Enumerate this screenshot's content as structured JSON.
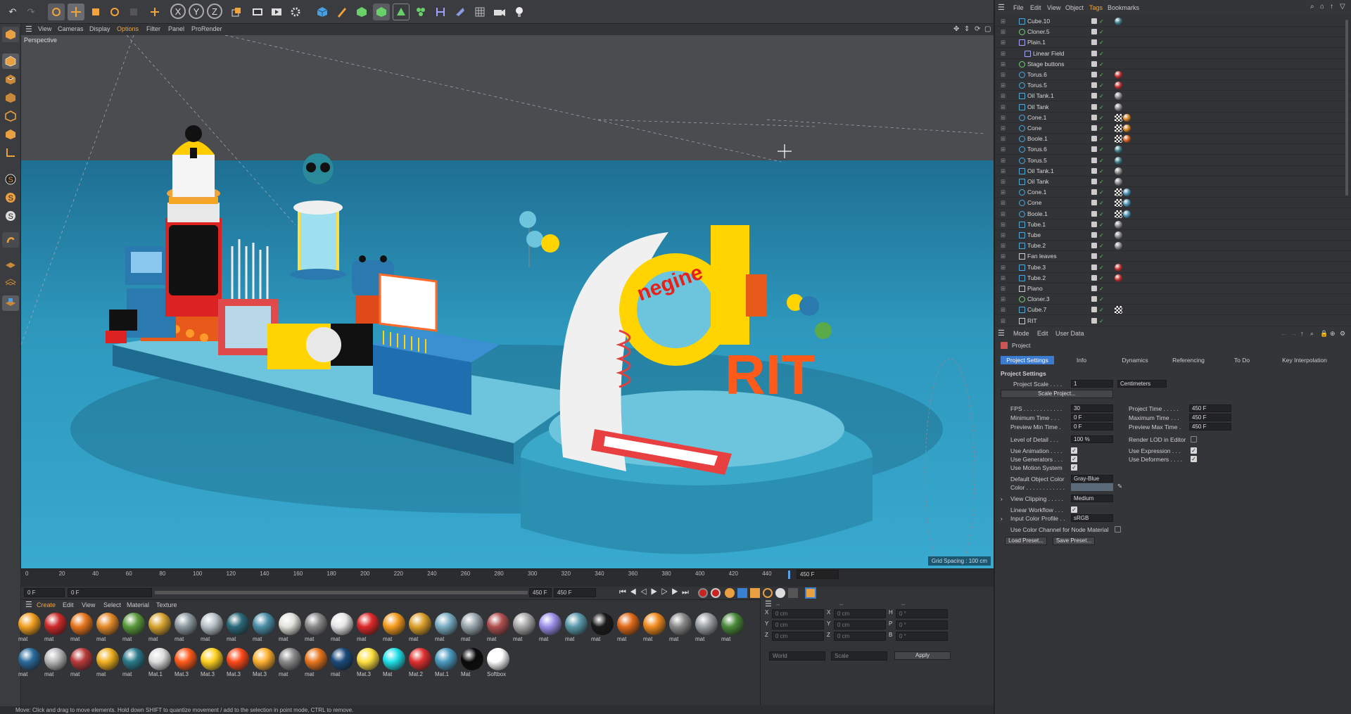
{
  "top_toolbar": {
    "undo": "↶",
    "redo": "↷",
    "axis_x": "X",
    "axis_y": "Y",
    "axis_z": "Z"
  },
  "viewport_menu": [
    "View",
    "Cameras",
    "Display",
    "Options",
    "Filter",
    "Panel",
    "ProRender"
  ],
  "viewport": {
    "label": "Perspective",
    "grid_spacing": "Grid Spacing : 100 cm",
    "scene_text": {
      "sign_logo": "negine",
      "rit_letters": "RIT"
    }
  },
  "timeline": {
    "ticks": [
      "0",
      "20",
      "40",
      "60",
      "80",
      "100",
      "120",
      "140",
      "160",
      "180",
      "200",
      "220",
      "240",
      "260",
      "280",
      "300",
      "320",
      "340",
      "360",
      "380",
      "400",
      "420",
      "440"
    ],
    "end_frame": "450 F",
    "current_start": "0 F",
    "preview_start": "0 F",
    "preview_end": "450 F",
    "end_value": "450 F"
  },
  "material_menu": [
    "Create",
    "Edit",
    "View",
    "Select",
    "Material",
    "Texture"
  ],
  "materials_row1": [
    {
      "label": "mat",
      "color": "#f0a020"
    },
    {
      "label": "mat",
      "color": "#cc2a2a"
    },
    {
      "label": "mat",
      "color": "#e8761e"
    },
    {
      "label": "mat",
      "color": "#e48a28"
    },
    {
      "label": "mat",
      "color": "#5a9a3a"
    },
    {
      "label": "mat",
      "color": "#d8a430"
    },
    {
      "label": "mat",
      "color": "#8e9aa2"
    },
    {
      "label": "mat",
      "color": "#b8c2c8"
    },
    {
      "label": "mat",
      "color": "#2a6a7a"
    },
    {
      "label": "mat",
      "color": "#4a8fa8"
    },
    {
      "label": "mat",
      "color": "#e2e2dc"
    },
    {
      "label": "mat",
      "color": "#8a8a8a"
    },
    {
      "label": "mat",
      "color": "#e6e6e6"
    },
    {
      "label": "mat",
      "color": "#dd2a2a"
    },
    {
      "label": "mat",
      "color": "#f59b1e"
    },
    {
      "label": "mat",
      "color": "#dca02a"
    },
    {
      "label": "mat",
      "color": "#7aaec4"
    },
    {
      "label": "mat",
      "color": "#9aa6ae"
    },
    {
      "label": "mat",
      "color": "#b05050"
    },
    {
      "label": "mat",
      "color": "#a8a8a8"
    },
    {
      "label": "mat",
      "color": "#9a8ee8"
    },
    {
      "label": "mat",
      "color": "#5a9aac"
    },
    {
      "label": "mat",
      "color": "#1a1a1a"
    },
    {
      "label": "mat",
      "color": "#e06a1a"
    },
    {
      "label": "mat",
      "color": "#f08a1e"
    },
    {
      "label": "mat",
      "color": "#8a8a8a"
    },
    {
      "label": "mat",
      "color": "#9aa0a4"
    },
    {
      "label": "mat",
      "color": "#4a8a3a"
    }
  ],
  "materials_row2": [
    {
      "label": "mat",
      "color": "#2a6a9a"
    },
    {
      "label": "mat",
      "color": "#b8b8b8"
    },
    {
      "label": "mat",
      "color": "#b83a3a"
    },
    {
      "label": "mat",
      "color": "#f0b020"
    },
    {
      "label": "mat",
      "color": "#2a7a8a"
    },
    {
      "label": "Mat.1",
      "color": "#dcdcdc"
    },
    {
      "label": "Mat.3",
      "color": "#ff5a1a"
    },
    {
      "label": "Mat.3",
      "color": "#ffd020"
    },
    {
      "label": "Mat.3",
      "color": "#ff4a1a"
    },
    {
      "label": "Mat.3",
      "color": "#ffb030"
    },
    {
      "label": "mat",
      "color": "#8a8a8a"
    },
    {
      "label": "mat",
      "color": "#e8761e"
    },
    {
      "label": "mat",
      "color": "#1a4a7a"
    },
    {
      "label": "Mat.3",
      "color": "#ffe040"
    },
    {
      "label": "Mat",
      "color": "#20e0e8"
    },
    {
      "label": "Mat.2",
      "color": "#e03030"
    },
    {
      "label": "Mat.1",
      "color": "#4a9ac0"
    },
    {
      "label": "Mat",
      "color": "#0a0a0a"
    },
    {
      "label": "Softbox",
      "color": "#ffffff"
    }
  ],
  "coords": {
    "rows": [
      {
        "axis": "X",
        "pos": "0 cm",
        "axis2": "X",
        "size": "0 cm",
        "axis3": "H",
        "rot": "0 °"
      },
      {
        "axis": "Y",
        "pos": "0 cm",
        "axis2": "Y",
        "size": "0 cm",
        "axis3": "P",
        "rot": "0 °"
      },
      {
        "axis": "Z",
        "pos": "0 cm",
        "axis2": "Z",
        "size": "0 cm",
        "axis3": "B",
        "rot": "0 °"
      }
    ],
    "mode1": "World",
    "mode2": "Scale",
    "apply": "Apply",
    "header1": "--",
    "header2": "--",
    "header3": "--"
  },
  "status_text": "Move: Click and drag to move elements. Hold down SHIFT to quantize movement / add to the selection in point mode, CTRL to remove.",
  "object_menu": [
    "File",
    "Edit",
    "View",
    "Object",
    "Tags",
    "Bookmarks"
  ],
  "objects": [
    {
      "name": "Cube.10",
      "icon": "cube",
      "indent": 1,
      "tags": [
        "#3d7a84"
      ]
    },
    {
      "name": "Cloner.5",
      "icon": "cloner",
      "indent": 1,
      "tags": []
    },
    {
      "name": "Plain.1",
      "icon": "deformer",
      "indent": 1,
      "tags": []
    },
    {
      "name": "Linear Field",
      "icon": "field",
      "indent": 2,
      "tags": []
    },
    {
      "name": "Stage buttons",
      "icon": "cloner",
      "indent": 1,
      "tags": []
    },
    {
      "name": "Torus.6",
      "icon": "torus",
      "indent": 1,
      "tags": [
        "#c03030"
      ]
    },
    {
      "name": "Torus.5",
      "icon": "torus",
      "indent": 1,
      "tags": [
        "#c03030"
      ]
    },
    {
      "name": "Oil Tank.1",
      "icon": "cube",
      "indent": 1,
      "tags": [
        "#888888"
      ]
    },
    {
      "name": "Oil Tank",
      "icon": "cube",
      "indent": 1,
      "tags": [
        "#888888"
      ]
    },
    {
      "name": "Cone.1",
      "icon": "cone",
      "indent": 1,
      "tags": [
        "checker",
        "#d08020"
      ]
    },
    {
      "name": "Cone",
      "icon": "cone",
      "indent": 1,
      "tags": [
        "checker",
        "#d08020"
      ]
    },
    {
      "name": "Boole.1",
      "icon": "boole",
      "indent": 1,
      "tags": [
        "checker",
        "#d06020"
      ]
    },
    {
      "name": "Torus.6",
      "icon": "torus",
      "indent": 1,
      "tags": [
        "#3d7a84"
      ]
    },
    {
      "name": "Torus.5",
      "icon": "torus",
      "indent": 1,
      "tags": [
        "#3d7a84"
      ]
    },
    {
      "name": "Oil Tank.1",
      "icon": "cube",
      "indent": 1,
      "tags": [
        "#888888"
      ]
    },
    {
      "name": "Oil Tank",
      "icon": "cube",
      "indent": 1,
      "tags": [
        "#888888"
      ]
    },
    {
      "name": "Cone.1",
      "icon": "cone",
      "indent": 1,
      "tags": [
        "checker",
        "#4a8fb0"
      ]
    },
    {
      "name": "Cone",
      "icon": "cone",
      "indent": 1,
      "tags": [
        "checker",
        "#4a8fb0"
      ]
    },
    {
      "name": "Boole.1",
      "icon": "boole",
      "indent": 1,
      "tags": [
        "checker",
        "#4a8fb0"
      ]
    },
    {
      "name": "Tube.1",
      "icon": "cube",
      "indent": 1,
      "tags": [
        "#888888"
      ]
    },
    {
      "name": "Tube",
      "icon": "cube",
      "indent": 1,
      "tags": [
        "#888888"
      ]
    },
    {
      "name": "Tube.2",
      "icon": "cube",
      "indent": 1,
      "tags": [
        "#888888"
      ]
    },
    {
      "name": "Fan leaves",
      "icon": "null",
      "indent": 1,
      "tags": []
    },
    {
      "name": "Tube.3",
      "icon": "cube",
      "indent": 1,
      "tags": [
        "#c03030"
      ]
    },
    {
      "name": "Tube.2",
      "icon": "cube",
      "indent": 1,
      "tags": [
        "#c03030"
      ]
    },
    {
      "name": "Piano",
      "icon": "null",
      "indent": 1,
      "tags": []
    },
    {
      "name": "Cloner.3",
      "icon": "cloner",
      "indent": 1,
      "tags": []
    },
    {
      "name": "Cube.7",
      "icon": "cube",
      "indent": 1,
      "tags": [
        "checker"
      ]
    },
    {
      "name": "RIT",
      "icon": "null",
      "indent": 1,
      "tags": []
    }
  ],
  "attr_menu": [
    "Mode",
    "Edit",
    "User Data"
  ],
  "attr": {
    "title": "Project",
    "tabs": [
      "Project Settings",
      "Info",
      "Dynamics",
      "Referencing",
      "To Do",
      "Key Interpolation"
    ],
    "section": "Project Settings",
    "project_scale_label": "Project Scale . . . .",
    "project_scale": "1",
    "scale_unit": "Centimeters",
    "scale_project_btn": "Scale Project...",
    "fps_label": "FPS . . . . . . . . . . . .",
    "fps": "30",
    "min_time_label": "Minimum Time . . .",
    "min_time": "0 F",
    "prev_min_label": "Preview Min Time .",
    "prev_min": "0 F",
    "proj_time_label": "Project Time . . . . .",
    "proj_time": "450 F",
    "max_time_label": "Maximum Time . . .",
    "max_time": "450 F",
    "prev_max_label": "Preview Max Time .",
    "prev_max": "450 F",
    "lod_label": "Level of Detail . . .",
    "lod": "100 %",
    "render_lod_label": "Render LOD in Editor",
    "use_anim_label": "Use Animation . . . .",
    "use_gen_label": "Use Generators . . .",
    "use_motion_label": "Use Motion System",
    "use_expr_label": "Use Expression . . .",
    "use_def_label": "Use Deformers . . . .",
    "def_obj_color_label": "Default Object Color",
    "def_obj_color": "Gray-Blue",
    "color_label": "Color . . . . . . . . . . . .",
    "view_clip_label": "View Clipping . . . . .",
    "view_clip": "Medium",
    "lin_workflow_label": "Linear Workflow . . .",
    "input_profile_label": "Input Color Profile . .",
    "input_profile": "sRGB",
    "node_mat_label": "Use Color Channel for Node Material",
    "load_preset": "Load Preset...",
    "save_preset": "Save Preset..."
  },
  "colors": {
    "accent": "#f2a33a",
    "select_tab": "#3b7bd0",
    "sky": "#4b4c4f",
    "floor": "#2e98bd"
  }
}
